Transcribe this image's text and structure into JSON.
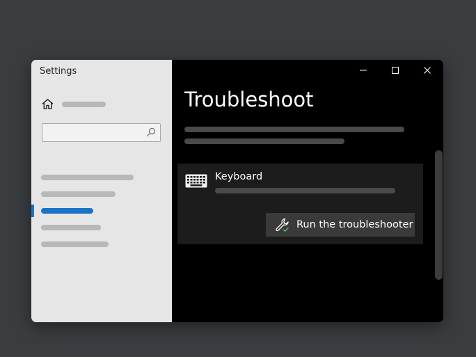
{
  "window": {
    "app_title": "Settings"
  },
  "sidebar": {
    "home_icon": "home-icon",
    "search_icon": "search-icon",
    "search_value": "",
    "selected_index": 2,
    "accent_color": "#1b73c9"
  },
  "main": {
    "title": "Troubleshoot",
    "card": {
      "icon": "keyboard-icon",
      "title": "Keyboard",
      "button_icon": "wrench-check-icon",
      "button_label": "Run the troubleshooter"
    }
  },
  "title_controls": [
    "minimize-icon",
    "maximize-icon",
    "close-icon"
  ]
}
